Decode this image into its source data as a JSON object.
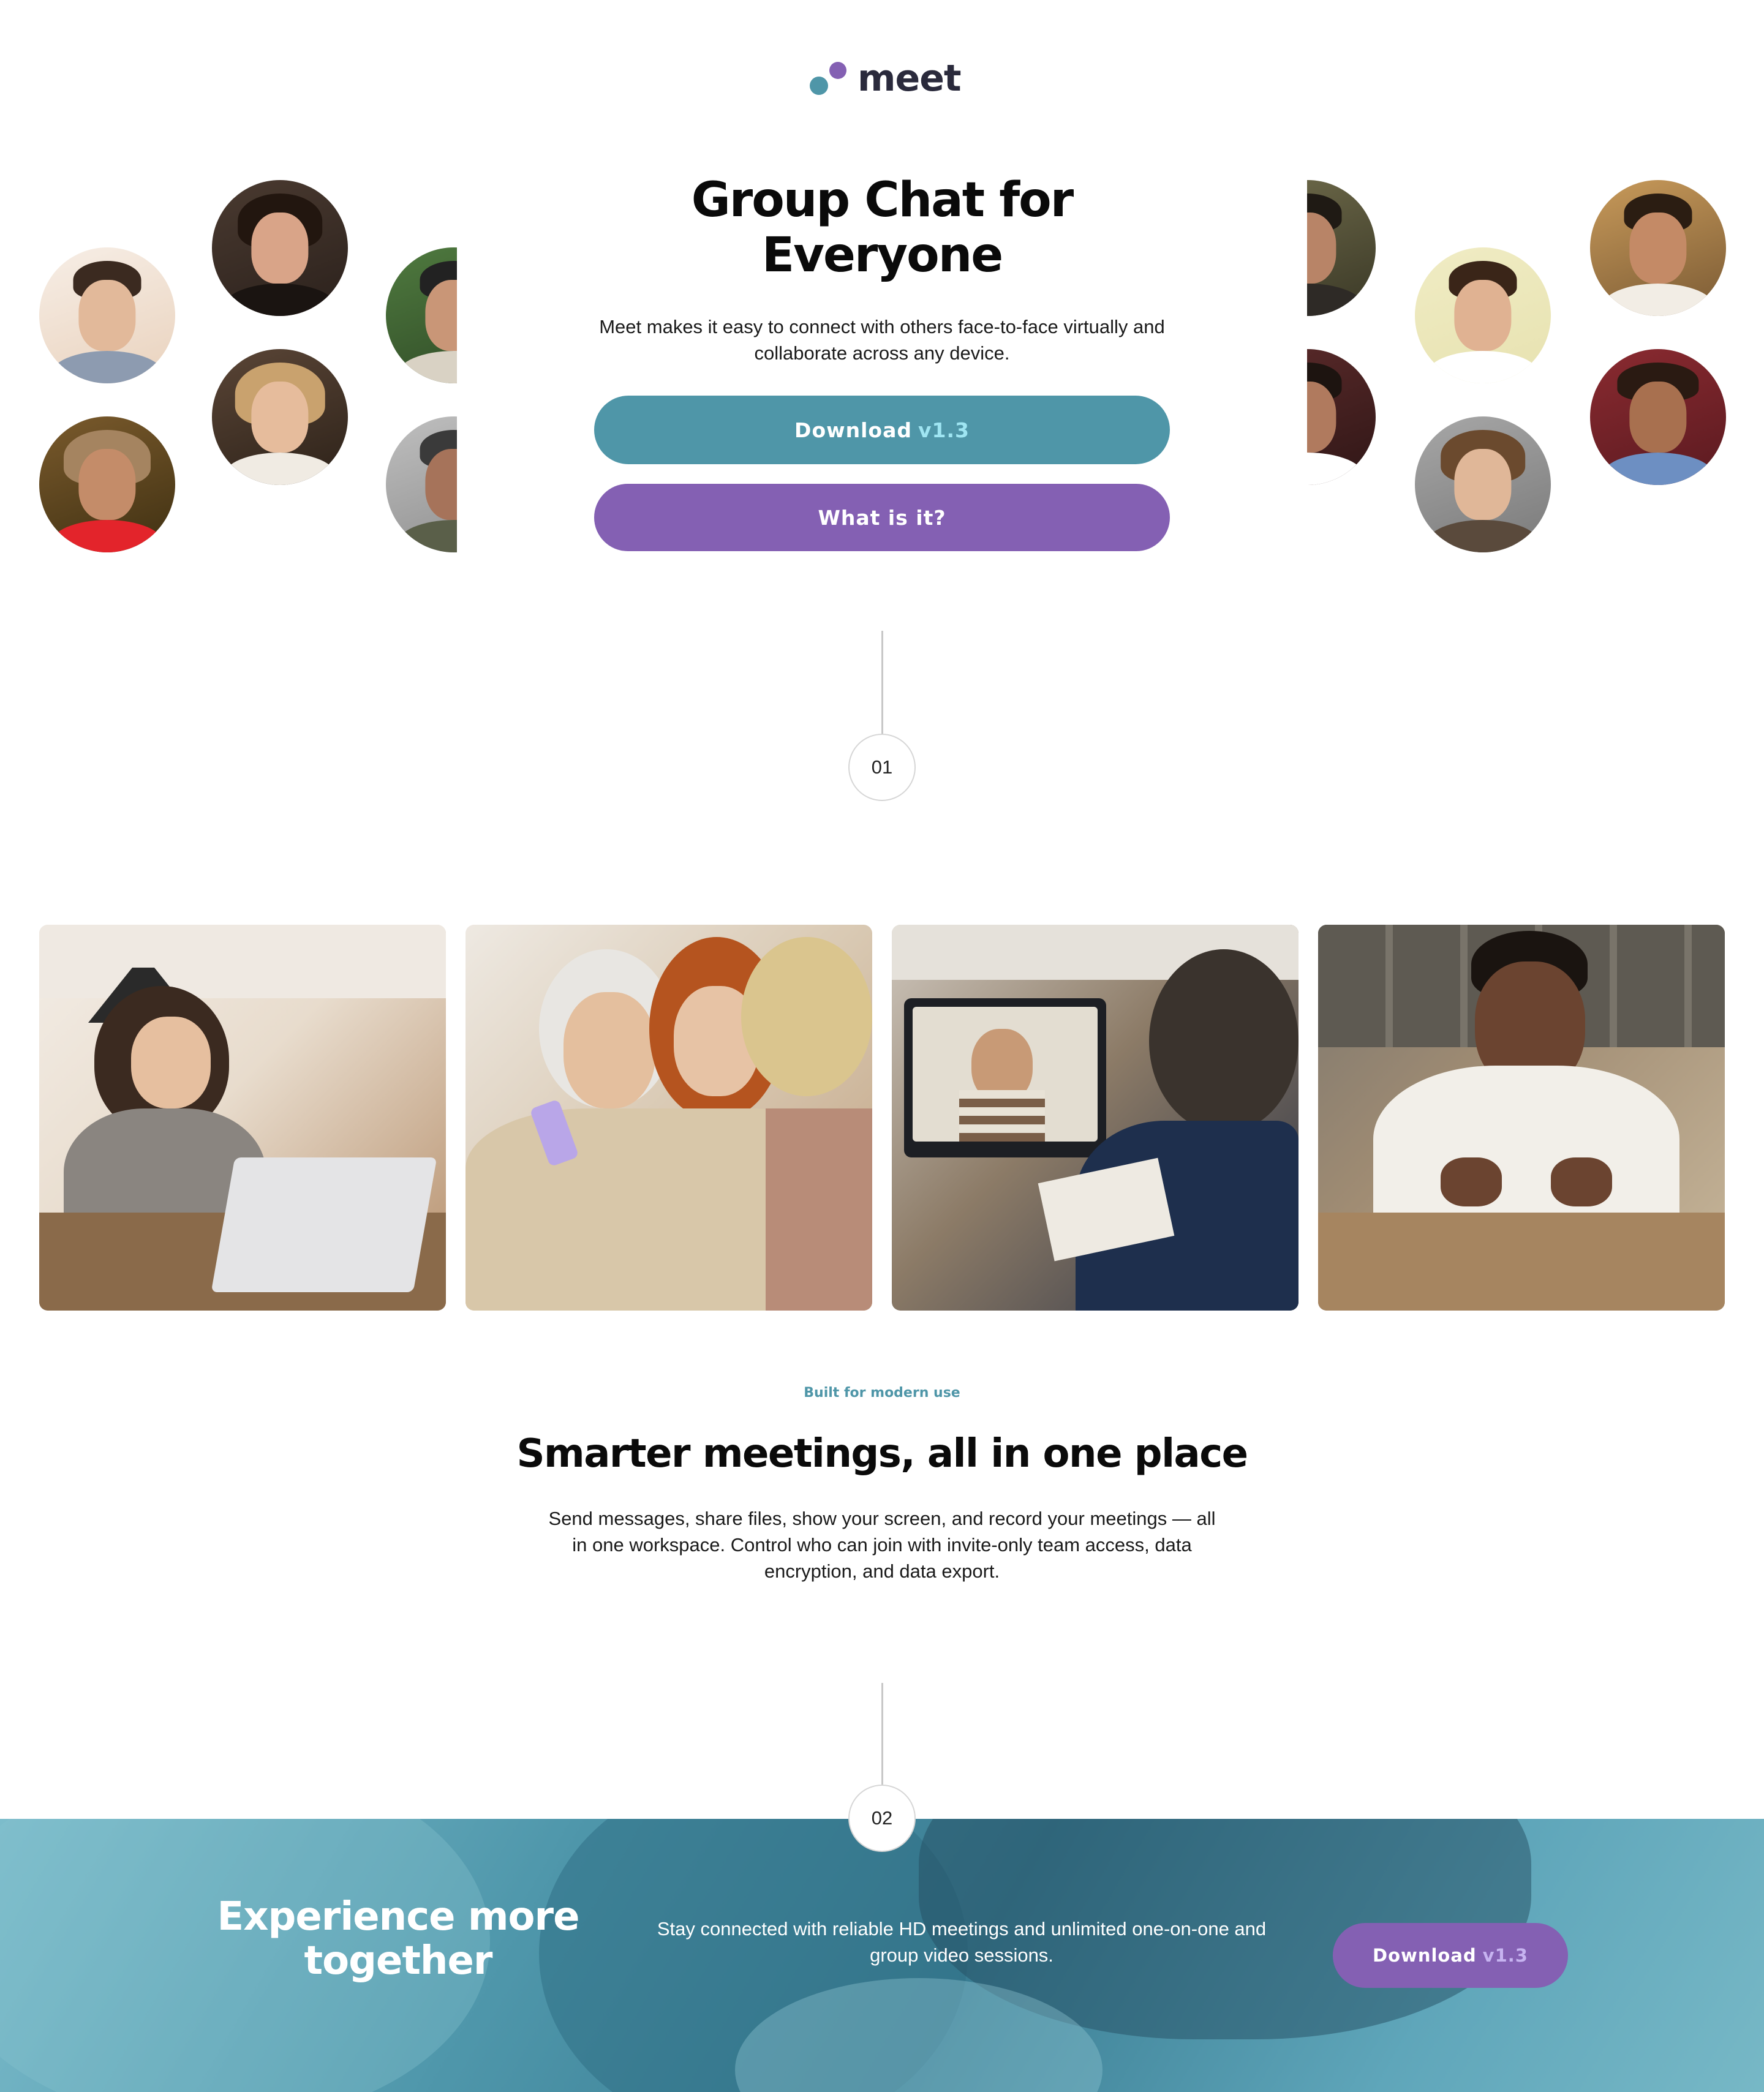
{
  "brand": {
    "name": "meet",
    "colors": {
      "teal": "#4f96a8",
      "purple": "#8460b3",
      "dark": "#2a2a3c"
    }
  },
  "hero": {
    "title": "Group Chat for Everyone",
    "subtitle": "Meet makes it easy to connect with others face-to-face virtually and collaborate across any device.",
    "download_label": "Download",
    "download_version": "v1.3",
    "what_label": "What is it?"
  },
  "steps": {
    "first": "01",
    "second": "02"
  },
  "features": {
    "eyebrow": "Built for modern use",
    "title": "Smarter meetings, all in one place",
    "body": "Send messages, share files, show your screen, and record your meetings — all in one workspace. Control who can join with invite-only team access, data encryption, and data export."
  },
  "cta": {
    "title": "Experience more together",
    "body": "Stay connected with reliable HD meetings and unlimited one-on-one and group video sessions.",
    "download_label": "Download",
    "download_version": "v1.3"
  }
}
